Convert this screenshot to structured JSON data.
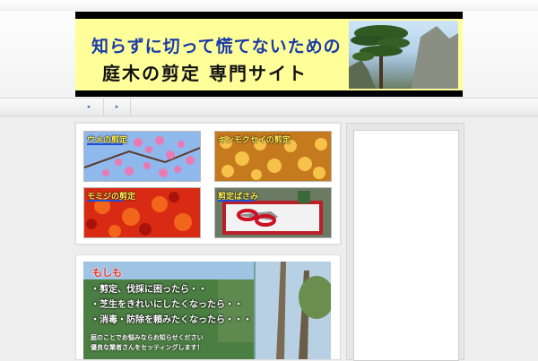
{
  "banner": {
    "title_line1": "知らずに切って慌てないための",
    "title_line2": "庭木の剪定 専門サイト"
  },
  "nav": {
    "items": [
      {
        "label": "▸"
      },
      {
        "label": "▸"
      }
    ]
  },
  "tiles": [
    {
      "label": "ウメの剪定"
    },
    {
      "label": "キンモクセイの剪定"
    },
    {
      "label": "モミジの剪定"
    },
    {
      "label": "剪定ばさみ"
    }
  ],
  "ad": {
    "heading": "もしも",
    "lines": [
      "・剪定、伐採に困ったら・・",
      "・芝生をきれいにしたくなったら・・",
      "・消毒・防除を頼みたくなったら・・・"
    ],
    "footer_line1": "庭のことでお悩みならお知らせください",
    "footer_line2": "優良な業者さんをセッティングします！"
  },
  "colors": {
    "banner_bg": "#ffff9a",
    "banner_title1": "#1a3aa8",
    "tile_label": "#ffee55",
    "ad_heading": "#e8332b"
  }
}
